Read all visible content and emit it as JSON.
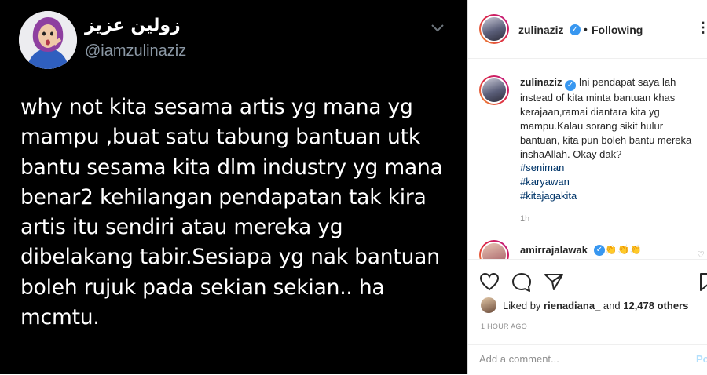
{
  "image": {
    "display_name": "زولين عزيز",
    "handle": "@iamzulinaziz",
    "tweet_text": "why not kita sesama artis yg mana yg\nmampu ,buat satu tabung bantuan utk\nbantu sesama kita dlm industry yg mana\nbenar2 kehilangan pendapatan tak kira\nartis itu sendiri atau mereka yg\ndibelakang tabir.Sesiapa yg nak bantuan\nboleh rujuk pada sekian sekian.. ha\nmcmtu."
  },
  "header": {
    "username": "zulinaziz",
    "separator": "•",
    "follow_status": "Following",
    "more_icon": "more-icon"
  },
  "caption": {
    "username": "zulinaziz",
    "text": "Ini pendapat saya lah\ninstead of kita minta bantuan khas\nkerajaan,ramai diantara kita yg\nmampu.Kalau sorang sikit hulur\nbantuan, kita pun boleh bantu mereka\ninshaAllah. Okay dak?",
    "hashtags": [
      "#seniman",
      "#karyawan",
      "#kitajagakita"
    ],
    "time_ago": "1h"
  },
  "comment": {
    "username": "amirrajalawak",
    "text": "👏👏👏"
  },
  "actions": {
    "icons": [
      "heart-icon",
      "comment-icon",
      "share-icon",
      "bookmark-icon"
    ]
  },
  "likes": {
    "prefix": "Liked by ",
    "user": "rienadiana_",
    "middle": " and ",
    "others": "12,478 others"
  },
  "timestamp": "1 HOUR AGO",
  "comment_box": {
    "placeholder": "Add a comment...",
    "post_label": "Post"
  },
  "colors": {
    "verified": "#3897f0",
    "hashtag": "#003569",
    "post_disabled": "#b2dffc"
  }
}
